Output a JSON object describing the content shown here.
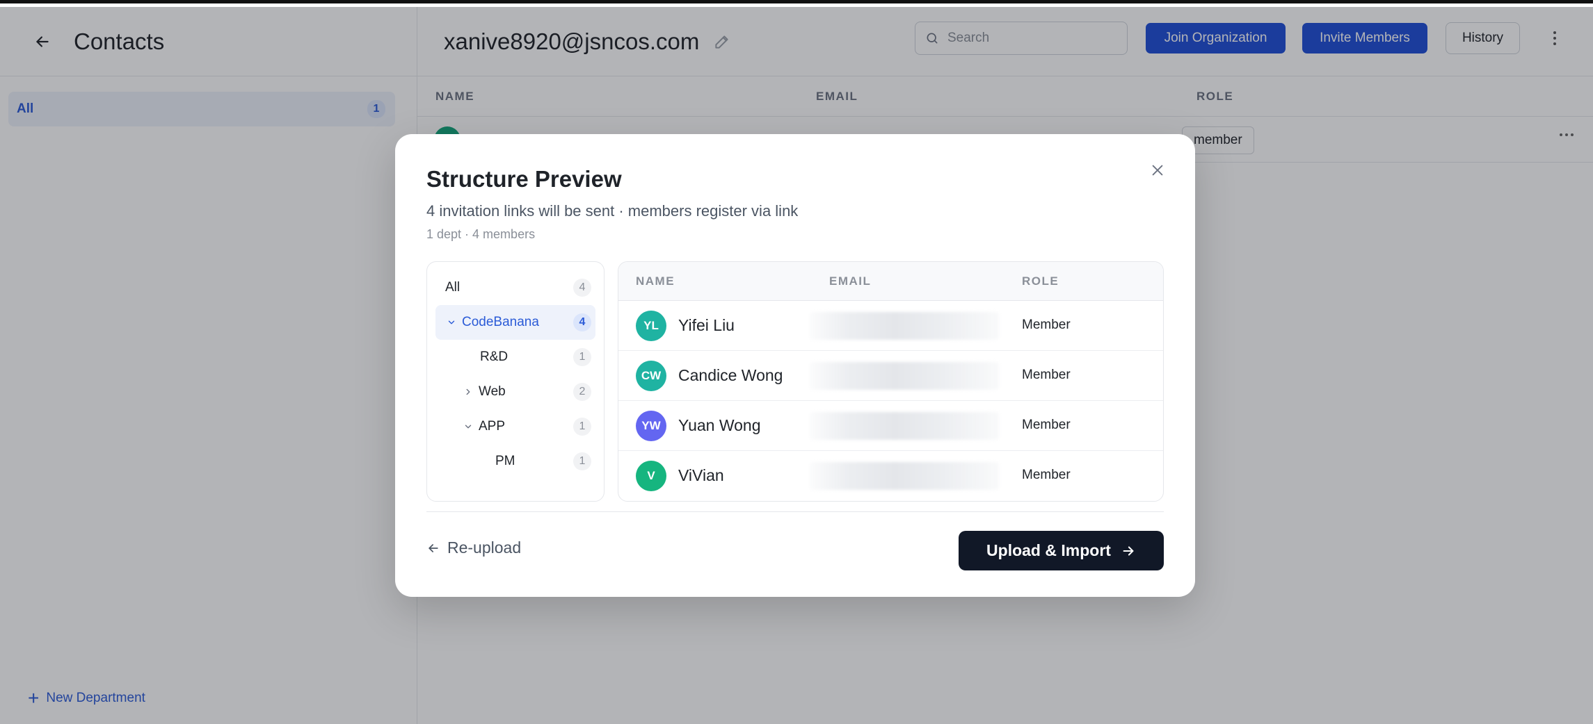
{
  "sidebar": {
    "title": "Contacts",
    "all_label": "All",
    "all_count": "1",
    "new_department": "New Department"
  },
  "header": {
    "title": "xanive8920@jsncos.com",
    "search_placeholder": "Search",
    "join_org": "Join Organization",
    "invite_members": "Invite Members",
    "history": "History"
  },
  "table": {
    "columns": [
      "NAME",
      "EMAIL",
      "ROLE"
    ],
    "rows": [
      {
        "role": "member"
      }
    ]
  },
  "modal": {
    "title": "Structure Preview",
    "subtitle": "4 invitation links will be sent · members register via link",
    "meta": "1 dept · 4 members",
    "tree": [
      {
        "label": "All",
        "count": "4"
      },
      {
        "label": "CodeBanana",
        "count": "4"
      },
      {
        "label": "R&D",
        "count": "1"
      },
      {
        "label": "Web",
        "count": "2"
      },
      {
        "label": "APP",
        "count": "1"
      },
      {
        "label": "PM",
        "count": "1"
      }
    ],
    "columns": [
      "NAME",
      "EMAIL",
      "ROLE"
    ],
    "members": [
      {
        "initials": "YL",
        "name": "Yifei Liu",
        "role": "Member",
        "color": "#1fb3a2"
      },
      {
        "initials": "CW",
        "name": "Candice Wong",
        "role": "Member",
        "color": "#1fb3a2"
      },
      {
        "initials": "YW",
        "name": "Yuan Wong",
        "role": "Member",
        "color": "#6366f1"
      },
      {
        "initials": "V",
        "name": "ViVian",
        "role": "Member",
        "color": "#16b57f"
      }
    ],
    "reupload": "Re-upload",
    "upload_import": "Upload & Import"
  },
  "colors": {
    "accent": "#1f4fd8",
    "primary_dark": "#111827"
  }
}
